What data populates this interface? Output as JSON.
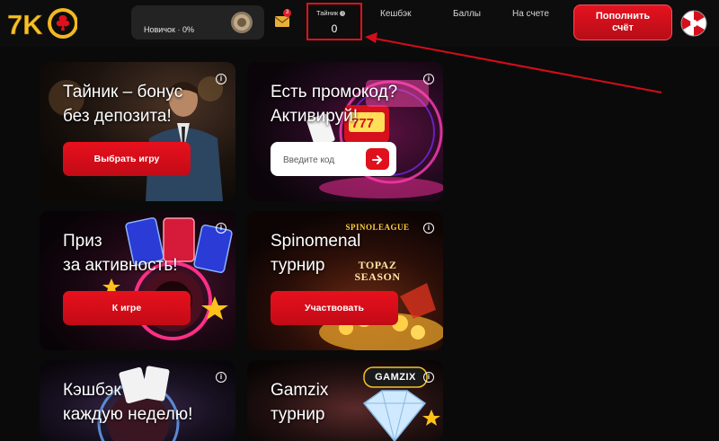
{
  "header": {
    "logo_text": "7K",
    "level_text": "Новичок · 0%",
    "mail_count": "3",
    "tabs": [
      {
        "label": "Тайник",
        "value": "0"
      },
      {
        "label": "Кешбэк"
      },
      {
        "label": "Баллы"
      },
      {
        "label": "На счете"
      }
    ],
    "deposit_label": "Пополнить\nсчёт"
  },
  "cards": [
    {
      "title": "Тайник – бонус\nбез депозита!",
      "button": "Выбрать игру",
      "info": "i"
    },
    {
      "title": "Есть промокод?\nАктивируй!",
      "input_placeholder": "Введите код",
      "info": "i",
      "slot_text": "777"
    },
    {
      "title": "Приз\nза активность!",
      "button": "К игре",
      "info": "i"
    },
    {
      "title": "Spinomenal\nтурнир",
      "button": "Участвовать",
      "info": "i",
      "badge_top": "SPINOLEAGUE",
      "badge_mid": "TOPAZ\nSEASON"
    },
    {
      "title": "Кэшбэк\nкаждую неделю!",
      "info": "i"
    },
    {
      "title": "Gamzix\nтурнир",
      "info": "i",
      "badge_top": "GAMZIX"
    }
  ],
  "colors": {
    "accent": "#e0101c",
    "background": "#0a0a0a",
    "header": "#0d0d0d"
  }
}
